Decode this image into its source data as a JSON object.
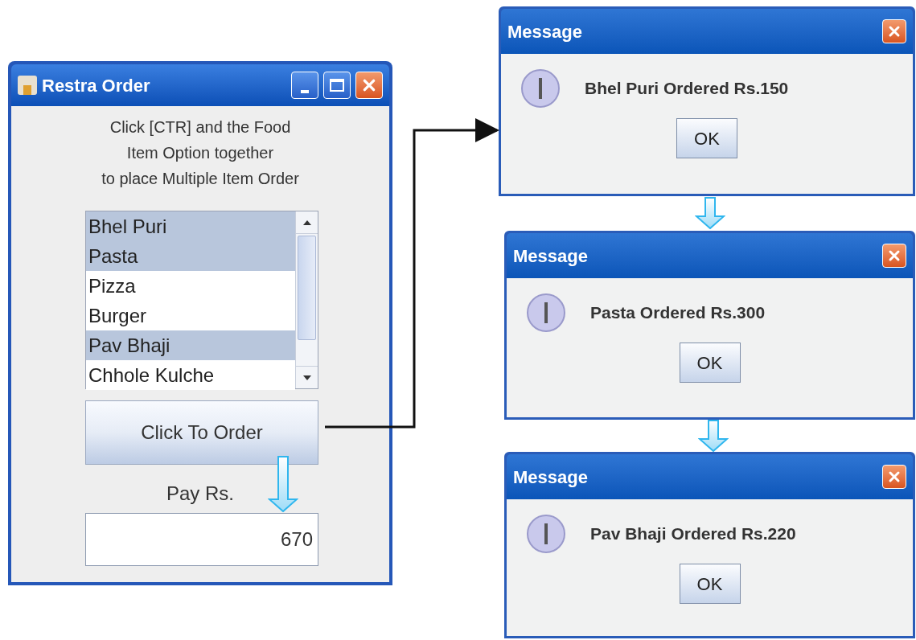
{
  "main_window": {
    "title": "Restra Order",
    "instructions": [
      "Click [CTR] and the Food",
      "Item Option together",
      "to place Multiple Item Order"
    ],
    "list_items": [
      {
        "label": "Bhel Puri",
        "selected": true
      },
      {
        "label": "Pasta",
        "selected": true
      },
      {
        "label": "Pizza",
        "selected": false
      },
      {
        "label": "Burger",
        "selected": false
      },
      {
        "label": "Pav Bhaji",
        "selected": true
      },
      {
        "label": "Chhole Kulche",
        "selected": false
      }
    ],
    "order_button": "Click To Order",
    "pay_label": "Pay Rs.",
    "pay_value": "670"
  },
  "dialogs": [
    {
      "title": "Message",
      "message": "Bhel Puri Ordered Rs.150",
      "button": "OK"
    },
    {
      "title": "Message",
      "message": "Pasta Ordered Rs.300",
      "button": "OK"
    },
    {
      "title": "Message",
      "message": "Pav Bhaji Ordered Rs.220",
      "button": "OK"
    }
  ]
}
